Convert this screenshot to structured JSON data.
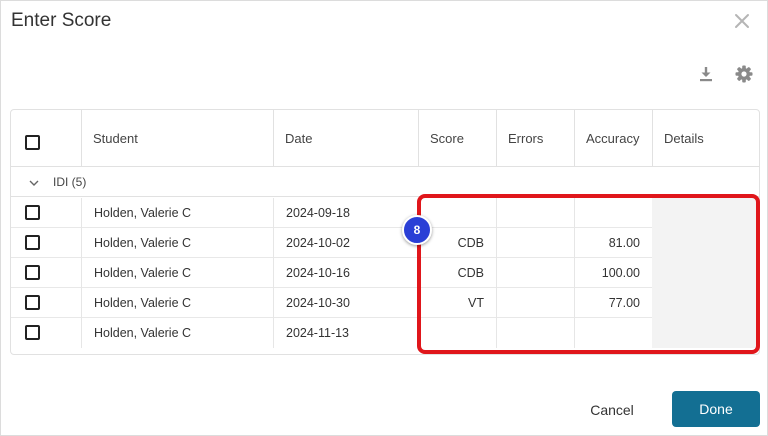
{
  "dialog": {
    "title": "Enter Score"
  },
  "toolbar": {
    "download_icon": "download-icon",
    "settings_icon": "gear-icon",
    "close_icon": "close-icon"
  },
  "table": {
    "columns": [
      "Student",
      "Date",
      "Score",
      "Errors",
      "Accuracy",
      "Details"
    ],
    "group": {
      "label": "IDI (5)"
    },
    "rows": [
      {
        "student": "Holden, Valerie C",
        "date": "2024-09-18",
        "score": "",
        "errors": "",
        "accuracy": ""
      },
      {
        "student": "Holden, Valerie C",
        "date": "2024-10-02",
        "score": "CDB",
        "errors": "",
        "accuracy": "81.00"
      },
      {
        "student": "Holden, Valerie C",
        "date": "2024-10-16",
        "score": "CDB",
        "errors": "",
        "accuracy": "100.00"
      },
      {
        "student": "Holden, Valerie C",
        "date": "2024-10-30",
        "score": "VT",
        "errors": "",
        "accuracy": "77.00"
      },
      {
        "student": "Holden, Valerie C",
        "date": "2024-11-13",
        "score": "",
        "errors": "",
        "accuracy": ""
      }
    ]
  },
  "footer": {
    "cancel_label": "Cancel",
    "done_label": "Done"
  },
  "annotation": {
    "step_number": "8",
    "highlight_color": "#e0161b",
    "badge_color": "#2a3fd6"
  },
  "colors": {
    "primary": "#136f93"
  }
}
